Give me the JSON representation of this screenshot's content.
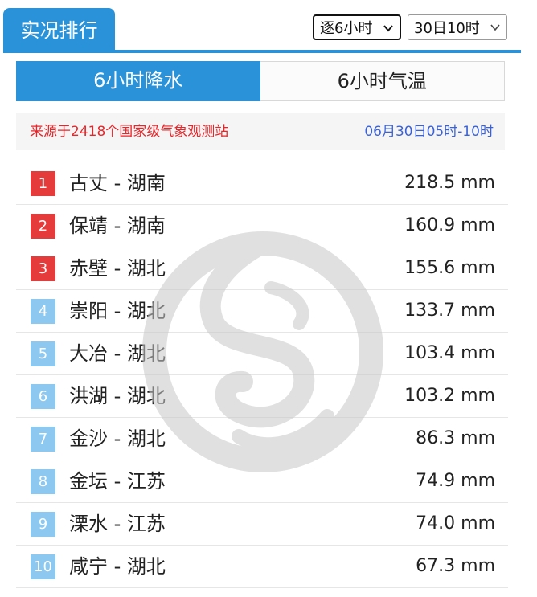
{
  "header": {
    "title": "实况排行",
    "interval_select": "逐6小时",
    "time_select": "30日10时"
  },
  "tabs": [
    {
      "label": "6小时降水",
      "active": true
    },
    {
      "label": "6小时气温",
      "active": false
    }
  ],
  "source": {
    "text": "来源于2418个国家级气象观测站",
    "period": "06月30日05时-10时"
  },
  "rankings": [
    {
      "rank": "1",
      "name": "古丈 - 湖南",
      "value": "218.5 mm"
    },
    {
      "rank": "2",
      "name": "保靖 - 湖南",
      "value": "160.9 mm"
    },
    {
      "rank": "3",
      "name": "赤壁 - 湖北",
      "value": "155.6 mm"
    },
    {
      "rank": "4",
      "name": "崇阳 - 湖北",
      "value": "133.7 mm"
    },
    {
      "rank": "5",
      "name": "大冶 - 湖北",
      "value": "103.4 mm"
    },
    {
      "rank": "6",
      "name": "洪湖 - 湖北",
      "value": "103.2 mm"
    },
    {
      "rank": "7",
      "name": "金沙 - 湖北",
      "value": "86.3 mm"
    },
    {
      "rank": "8",
      "name": "金坛 - 江苏",
      "value": "74.9 mm"
    },
    {
      "rank": "9",
      "name": "溧水 - 江苏",
      "value": "74.0 mm"
    },
    {
      "rank": "10",
      "name": "咸宁 - 湖北",
      "value": "67.3 mm"
    }
  ],
  "colors": {
    "accent": "#2a92d8",
    "top_rank": "#e53b3b",
    "other_rank": "#8cc8ef",
    "source_text": "#e8262a",
    "period_text": "#3a62d8"
  },
  "icons": {
    "dropdown": "chevron-down-icon",
    "watermark": "dragon-logo-watermark"
  }
}
